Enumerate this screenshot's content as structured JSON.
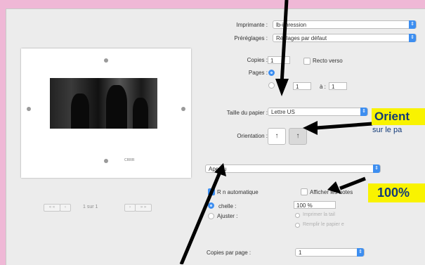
{
  "printer": {
    "label": "Imprimante :",
    "value": "lb-imression"
  },
  "presets": {
    "label": "Préréglages :",
    "value": "Réglages par défaut"
  },
  "copies": {
    "label": "Copies :",
    "value": "1",
    "recto_verso": "Recto verso"
  },
  "pages": {
    "label": "Pages :",
    "from_prefix": "d",
    "from_value": "1",
    "to_label": "à :",
    "to_value": "1"
  },
  "paper_size": {
    "label": "Taille du papier :",
    "value": "Lettre US"
  },
  "orientation": {
    "label": "Orientation :",
    "portrait_icon": "↑",
    "landscape_icon": "↑",
    "selected": "landscape"
  },
  "section_select": {
    "value": "Aperçu"
  },
  "auto_rotate": {
    "label": "R n automatique",
    "checked": true
  },
  "show_notes": {
    "label": "Afficher les notes",
    "checked": false
  },
  "scale": {
    "label": "chelle :",
    "value": "100 %"
  },
  "fit": {
    "label": "Ajuster :",
    "option1": "Imprimer la tail",
    "option2": "Remplir le papier e"
  },
  "copies_per_page": {
    "label": "Copies par page :",
    "value": "1"
  },
  "preview": {
    "page_status": "1 sur 1",
    "first": "« «",
    "prev": "‹",
    "next": "›",
    "last": "» »",
    "tiny_caption": "CRRR"
  },
  "callouts": {
    "orientation": "Orient",
    "orientation_sub": "sur le pa",
    "scale": "100%"
  },
  "colors": {
    "accent": "#3d8ef0",
    "callout_bg": "#f9f300",
    "callout_text": "#123a78",
    "frame": "#efb8d6"
  },
  "icons": [
    "chevron-updown-icon",
    "portrait-icon",
    "landscape-icon",
    "checkmark-icon"
  ]
}
